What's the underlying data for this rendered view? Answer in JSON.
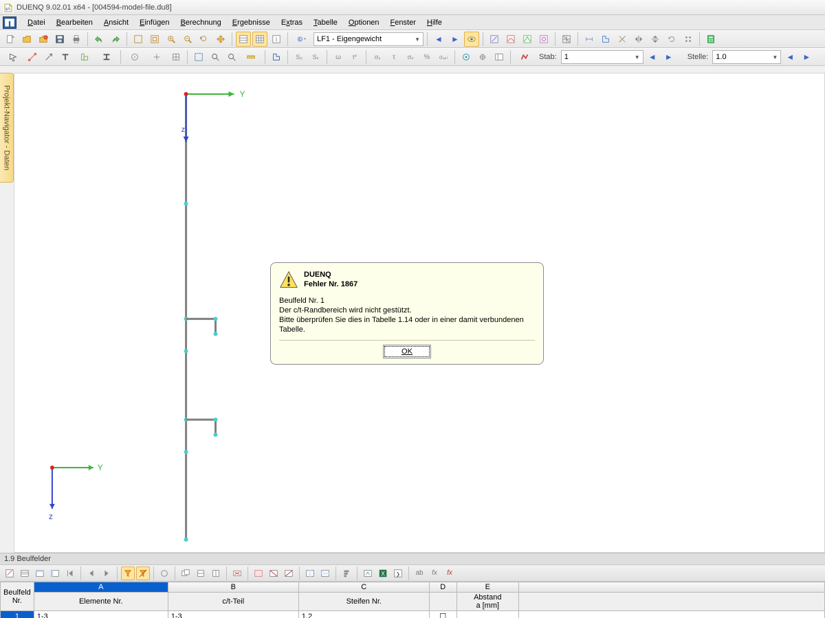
{
  "title": "DUENQ 9.02.01 x64 - [004594-model-file.du8]",
  "menu": {
    "items": [
      "Datei",
      "Bearbeiten",
      "Ansicht",
      "Einfügen",
      "Berechnung",
      "Ergebnisse",
      "Extras",
      "Tabelle",
      "Optionen",
      "Fenster",
      "Hilfe"
    ]
  },
  "toolbar1": {
    "loadcase_combo": "LF1 - Eigengewicht"
  },
  "toolbar2": {
    "stab_label": "Stab:",
    "stab_value": "1",
    "stelle_label": "Stelle:",
    "stelle_value": "1.0"
  },
  "sidebar": {
    "label": "Projekt-Navigator - Daten"
  },
  "canvas_axes": {
    "y": "Y",
    "z": "z",
    "y2": "Y",
    "z2": "z"
  },
  "dialog": {
    "app": "DUENQ",
    "error_no": "Fehler Nr. 1867",
    "line1": "Beulfeld Nr. 1",
    "line2": "Der c/t-Randbereich wird nicht gestützt.",
    "line3": "Bitte überprüfen Sie dies in Tabelle 1.14 oder in einer damit verbundenen Tabelle.",
    "ok": "OK"
  },
  "bottom": {
    "title": "1.9 Beulfelder",
    "col_letters": [
      "A",
      "B",
      "C",
      "D",
      "E"
    ],
    "col_labels": {
      "row": "Beulfeld\nNr.",
      "a": "Elemente Nr.",
      "b": "c/t-Teil",
      "c": "Steifen Nr.",
      "d": "",
      "e": "Abstand\na [mm]"
    },
    "rows": [
      {
        "nr": "1",
        "a": "1-3",
        "b": "1-3",
        "c": "1,2",
        "d": "☐",
        "e": ""
      }
    ]
  }
}
